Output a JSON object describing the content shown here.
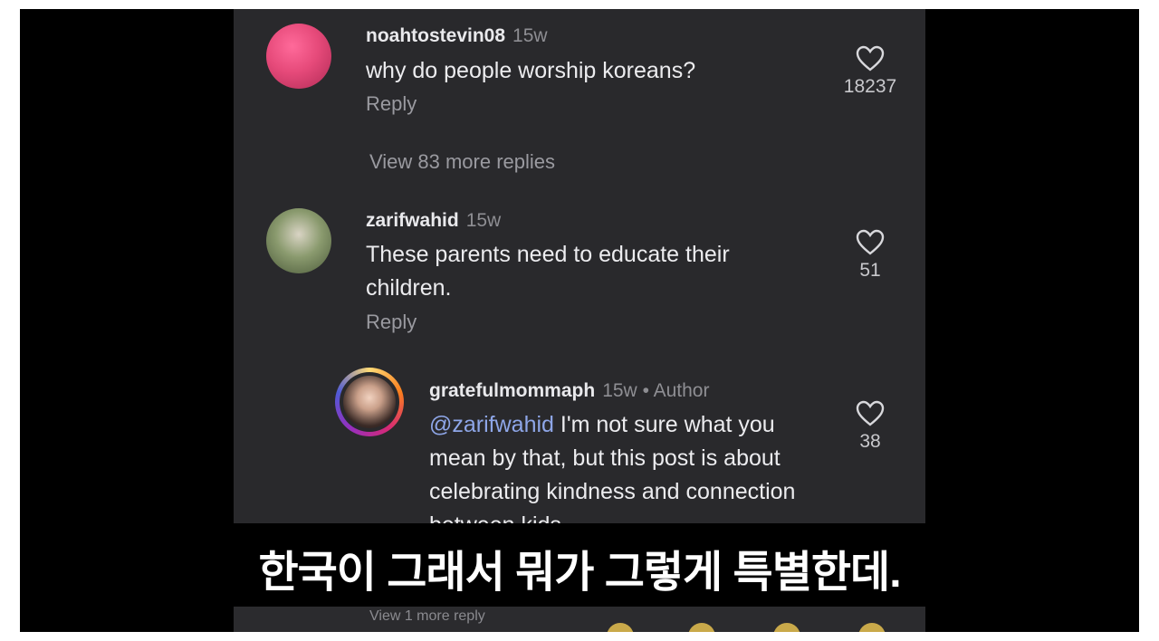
{
  "comments": [
    {
      "username": "noahtostevin08",
      "age": "15w",
      "text": "why do people worship koreans?",
      "reply_label": "Reply",
      "likes": "18237"
    },
    {
      "username": "zarifwahid",
      "age": "15w",
      "text": "These parents need to educate their children.",
      "reply_label": "Reply",
      "likes": "51"
    }
  ],
  "view_more_replies": "View 83 more replies",
  "reply_comment": {
    "username": "gratefulmommaph",
    "age": "15w",
    "author_label": "• Author",
    "mention": "@zarifwahid",
    "text": " I'm not sure what you mean by that, but this post is about celebrating kindness and connection between kids",
    "likes": "38"
  },
  "subtitle": "한국이 그래서 뭐가 그렇게 특별한데.",
  "below_fragment": "View 1 more reply",
  "colors": {
    "panel": "#29292c",
    "mention": "#8ea6e8",
    "avatar1": "#e64a7a",
    "story_ring": "#d6249f"
  },
  "icons": [
    "heart-icon"
  ]
}
